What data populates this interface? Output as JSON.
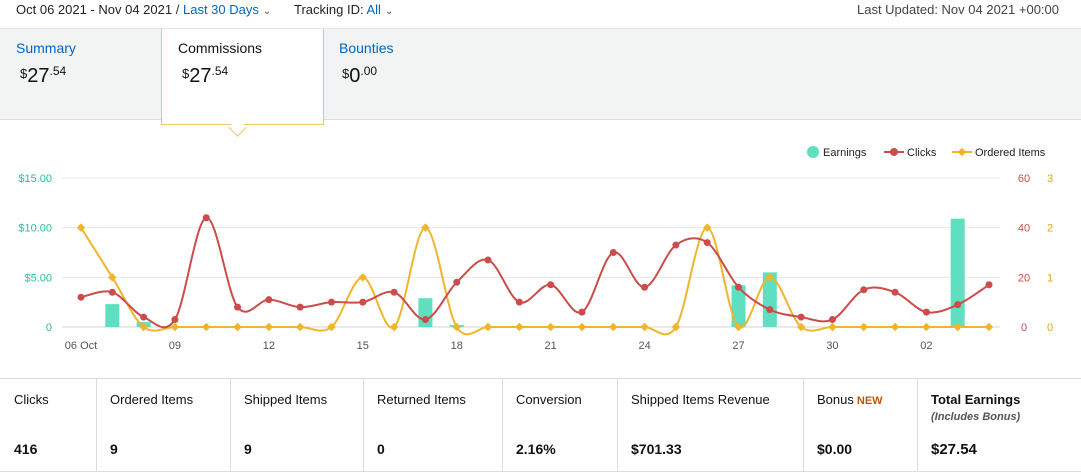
{
  "header": {
    "date_range": "Oct 06 2021 - Nov 04 2021",
    "range_sep": "/",
    "range_preset": "Last 30 Days",
    "tracking_label": "Tracking ID:",
    "tracking_value": "All",
    "last_updated": "Last Updated: Nov 04 2021 +00:00"
  },
  "tabs": [
    {
      "label": "Summary",
      "currency": "$",
      "whole": "27",
      "cents": ".54"
    },
    {
      "label": "Commissions",
      "currency": "$",
      "whole": "27",
      "cents": ".54"
    },
    {
      "label": "Bounties",
      "currency": "$",
      "whole": "0",
      "cents": ".00"
    }
  ],
  "chart_data": {
    "type": "line",
    "x": [
      "06 Oct",
      "07",
      "08",
      "09",
      "10",
      "11",
      "12",
      "13",
      "14",
      "15",
      "16",
      "17",
      "18",
      "19",
      "20",
      "21",
      "22",
      "23",
      "24",
      "25",
      "26",
      "27",
      "28",
      "29",
      "30",
      "31",
      "01",
      "02",
      "03",
      "04"
    ],
    "x_tick_labels": [
      "06 Oct",
      "09",
      "12",
      "15",
      "18",
      "21",
      "24",
      "27",
      "30",
      "02"
    ],
    "legend_position": "top-right",
    "legend": [
      "Earnings",
      "Clicks",
      "Ordered Items"
    ],
    "y_left": {
      "ticks": [
        "$15.00",
        "$10.00",
        "$5.00",
        "0"
      ],
      "range": [
        0,
        15
      ]
    },
    "y_right_clicks": {
      "ticks": [
        "60",
        "40",
        "20",
        "0"
      ],
      "range": [
        0,
        60
      ]
    },
    "y_right_items": {
      "ticks": [
        "3",
        "2",
        "1",
        "0"
      ],
      "range": [
        0,
        3
      ]
    },
    "series": [
      {
        "name": "Earnings",
        "type": "bar",
        "color": "#5ee0c0",
        "axis": "left",
        "values": [
          0,
          2.3,
          0.5,
          0.1,
          0,
          0,
          0,
          0,
          0,
          0,
          0,
          2.9,
          0.2,
          0,
          0,
          0,
          0,
          0,
          0,
          0,
          0,
          4.2,
          5.5,
          0,
          0,
          0,
          0,
          0,
          10.9,
          0
        ]
      },
      {
        "name": "Clicks",
        "type": "line",
        "color": "#cc4b4b",
        "axis": "right_clicks",
        "values": [
          12,
          14,
          4,
          3,
          44,
          8,
          11,
          8,
          10,
          10,
          14,
          3,
          18,
          27,
          10,
          17,
          6,
          30,
          16,
          33,
          34,
          16,
          7,
          4,
          3,
          15,
          14,
          6,
          9,
          17
        ]
      },
      {
        "name": "Ordered Items",
        "type": "line",
        "color": "#f0b52b",
        "axis": "right_items",
        "values": [
          2,
          1,
          0,
          0,
          0,
          0,
          0,
          0,
          0,
          1,
          0,
          2,
          0,
          0,
          0,
          0,
          0,
          0,
          0,
          0,
          2,
          0,
          1,
          0,
          0,
          0,
          0,
          0,
          0,
          0
        ]
      }
    ]
  },
  "stats": [
    {
      "label": "Clicks",
      "value": "416"
    },
    {
      "label": "Ordered Items",
      "value": "9"
    },
    {
      "label": "Shipped Items",
      "value": "9"
    },
    {
      "label": "Returned Items",
      "value": "0"
    },
    {
      "label": "Conversion",
      "value": "2.16%"
    },
    {
      "label": "Shipped Items Revenue",
      "value": "$701.33"
    },
    {
      "label": "Bonus",
      "badge": "NEW",
      "value": "$0.00"
    },
    {
      "label": "Total Earnings",
      "sublabel": "(Includes Bonus)",
      "value": "$27.54"
    }
  ]
}
